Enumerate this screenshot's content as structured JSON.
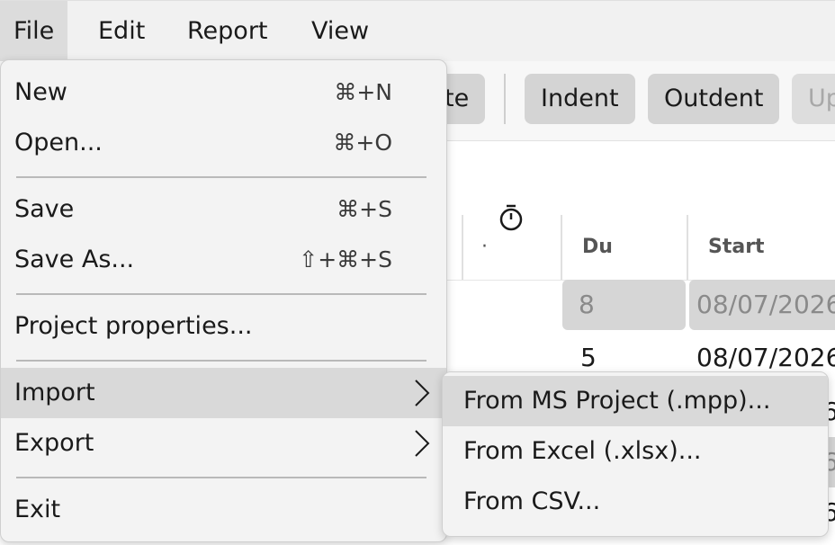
{
  "menubar": {
    "items": [
      {
        "label": "File"
      },
      {
        "label": "Edit"
      },
      {
        "label": "Report"
      },
      {
        "label": "View"
      }
    ]
  },
  "toolbar": {
    "partial_button_label": "te",
    "indent_label": "Indent",
    "outdent_label": "Outdent",
    "partial_disabled_label": "Up"
  },
  "table": {
    "columns": [
      {
        "label": "·"
      },
      {
        "label": "Du"
      },
      {
        "label": "Start"
      }
    ],
    "rows": [
      {
        "duration": "8",
        "start": "08/07/2026"
      },
      {
        "duration": "5",
        "start": "08/07/2026",
        "icon": "stopwatch-icon"
      }
    ],
    "partial_cells": [
      "6",
      "6",
      "6"
    ]
  },
  "file_menu": {
    "items": [
      {
        "label": "New",
        "shortcut": "⌘+N"
      },
      {
        "label": "Open...",
        "shortcut": "⌘+O"
      },
      {
        "label": "Save",
        "shortcut": "⌘+S"
      },
      {
        "label": "Save As...",
        "shortcut": "⇧+⌘+S"
      },
      {
        "label": "Project properties..."
      },
      {
        "label": "Import",
        "submenu": true
      },
      {
        "label": "Export",
        "submenu": true
      },
      {
        "label": "Exit"
      }
    ]
  },
  "import_submenu": {
    "items": [
      {
        "label": "From MS Project (.mpp)..."
      },
      {
        "label": "From Excel (.xlsx)..."
      },
      {
        "label": "From CSV..."
      }
    ]
  },
  "colors": {
    "menu_bg": "#f3f3f3",
    "highlight": "#d9d9d9",
    "button_bg": "#d4d4d4",
    "summary_cell": "#d6d6d6"
  }
}
